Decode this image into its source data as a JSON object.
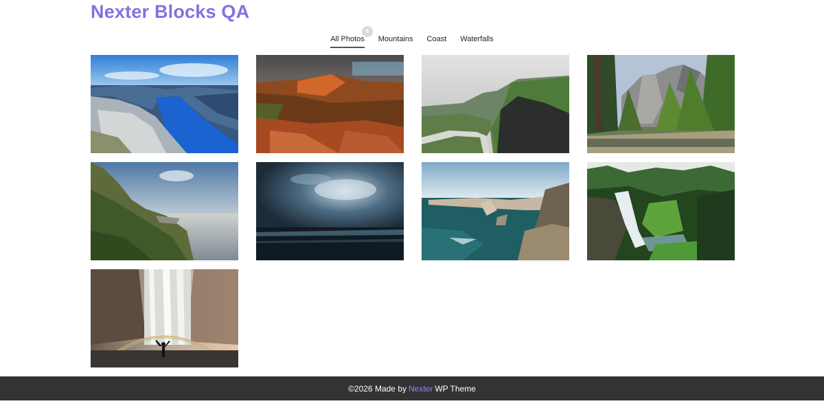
{
  "site": {
    "title": "Nexter Blocks QA",
    "accent": "#8072e4"
  },
  "filters": {
    "items": [
      {
        "label": "All Photos",
        "count": "9",
        "active": true
      },
      {
        "label": "Mountains"
      },
      {
        "label": "Coast"
      },
      {
        "label": "Waterfalls"
      }
    ]
  },
  "gallery": {
    "photos": [
      {
        "name": "fjord-cliff-photo"
      },
      {
        "name": "red-canyon-photo"
      },
      {
        "name": "green-ridge-road-photo"
      },
      {
        "name": "yosemite-forest-photo"
      },
      {
        "name": "coastal-hills-sunset-photo"
      },
      {
        "name": "stormy-sea-photo"
      },
      {
        "name": "sea-arch-coast-photo"
      },
      {
        "name": "forest-waterfall-photo"
      },
      {
        "name": "waterfall-rainbow-photo"
      }
    ]
  },
  "footer": {
    "prefix": "©2026 Made by",
    "link": "Nexter",
    "suffix": "WP Theme",
    "link_color": "#8f84f0",
    "background": "#333333"
  }
}
